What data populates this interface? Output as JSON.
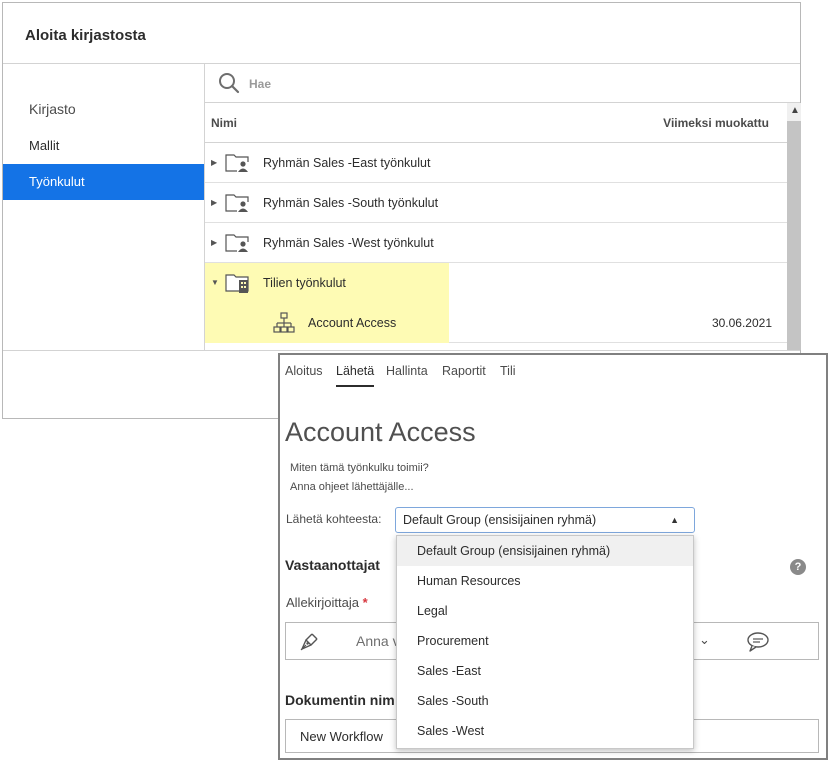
{
  "dialog": {
    "title": "Aloita kirjastosta",
    "sidebar": {
      "items": [
        {
          "label": "Kirjasto"
        },
        {
          "label": "Mallit"
        },
        {
          "label": "Työnkulut"
        }
      ]
    },
    "search": {
      "placeholder": "Hae"
    },
    "table": {
      "headers": {
        "name": "Nimi",
        "modified": "Viimeksi muokattu"
      },
      "rows": [
        {
          "name": "Ryhmän Sales -East työnkulut",
          "modified": ""
        },
        {
          "name": "Ryhmän Sales -South työnkulut",
          "modified": ""
        },
        {
          "name": "Ryhmän Sales -West työnkulut",
          "modified": ""
        },
        {
          "name": "Tilien työnkulut",
          "modified": ""
        },
        {
          "name": "Account Access",
          "modified": "30.06.2021"
        }
      ]
    }
  },
  "front": {
    "tabs": [
      {
        "label": "Aloitus"
      },
      {
        "label": "Lähetä"
      },
      {
        "label": "Hallinta"
      },
      {
        "label": "Raportit"
      },
      {
        "label": "Tili"
      }
    ],
    "title": "Account Access",
    "help_lines": [
      "Miten tämä työnkulku toimii?",
      "Anna ohjeet lähettäjälle..."
    ],
    "send_from": {
      "label": "Lähetä kohteesta:",
      "value": "Default Group (ensisijainen ryhmä)",
      "options": [
        "Default Group (ensisijainen ryhmä)",
        "Human Resources",
        "Legal",
        "Procurement",
        "Sales -East",
        "Sales -South",
        "Sales -West"
      ]
    },
    "recipients": {
      "heading": "Vastaanottajat",
      "help": "?",
      "signer_label": "Allekirjoittaja",
      "required_mark": "*",
      "signer_text": "Anna v"
    },
    "document": {
      "heading": "Dokumentin nim",
      "value": "New Workflow"
    }
  },
  "colors": {
    "accent": "#1473e6",
    "highlight": "#fefbb4",
    "required": "#d7373f"
  },
  "icons": [
    "search-icon",
    "caret-right-icon",
    "caret-down-icon",
    "shared-folder-icon",
    "account-folder-icon",
    "workflow-icon",
    "pen-icon",
    "chevron-down-icon",
    "comment-icon",
    "help-icon"
  ]
}
